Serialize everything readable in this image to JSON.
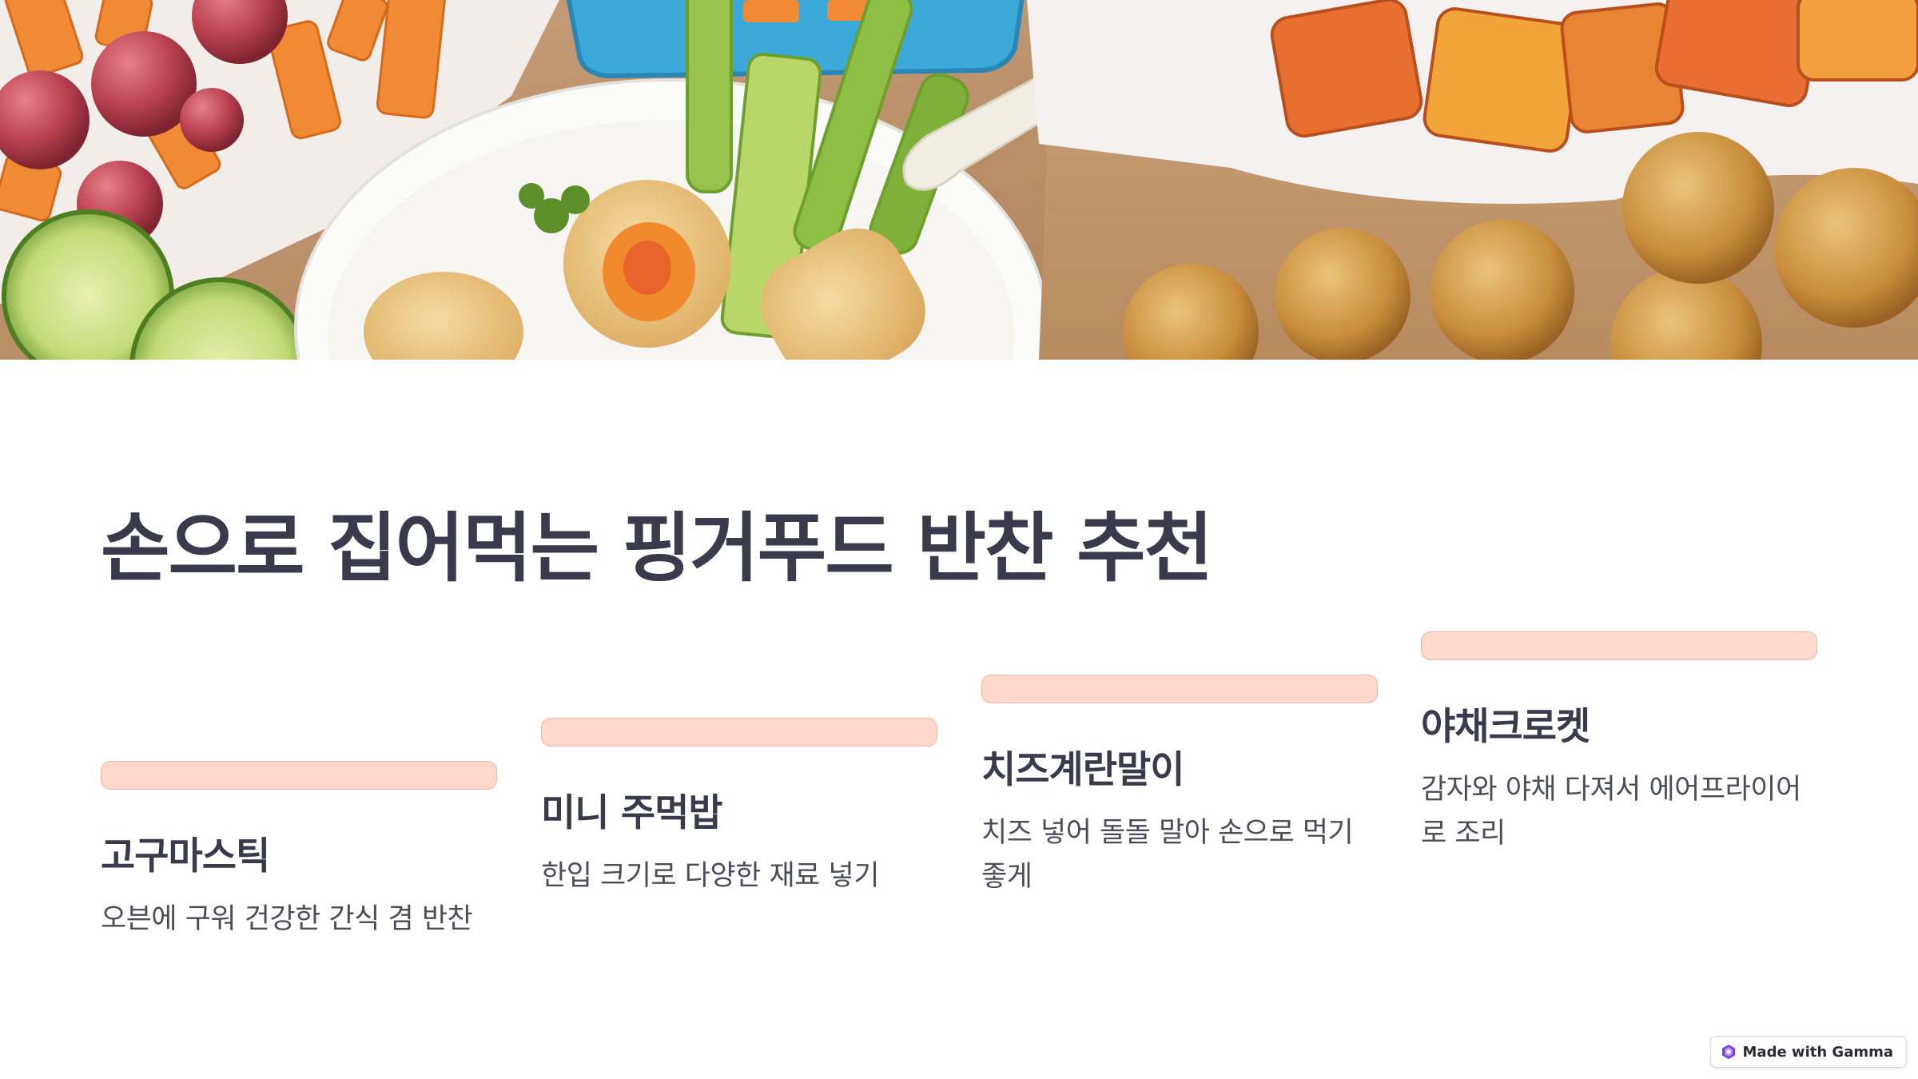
{
  "slide": {
    "title": "손으로 집어먹는 핑거푸드 반찬 추천",
    "accent_color": "#fdd8cb",
    "text_color": "#3a3a4c",
    "hero_image": "finger-food-platter-photo"
  },
  "cards": [
    {
      "title": "고구마스틱",
      "description": "오븐에 구워 건강한 간식 겸 반찬"
    },
    {
      "title": "미니 주먹밥",
      "description": "한입 크기로 다양한 재료 넣기"
    },
    {
      "title": "치즈계란말이",
      "description": "치즈 넣어 돌돌 말아 손으로 먹기 좋게"
    },
    {
      "title": "야채크로켓",
      "description": "감자와 야채 다져서 에어프라이어로 조리"
    }
  ],
  "badge": {
    "label": "Made with Gamma",
    "icon": "gamma-logo-icon"
  }
}
